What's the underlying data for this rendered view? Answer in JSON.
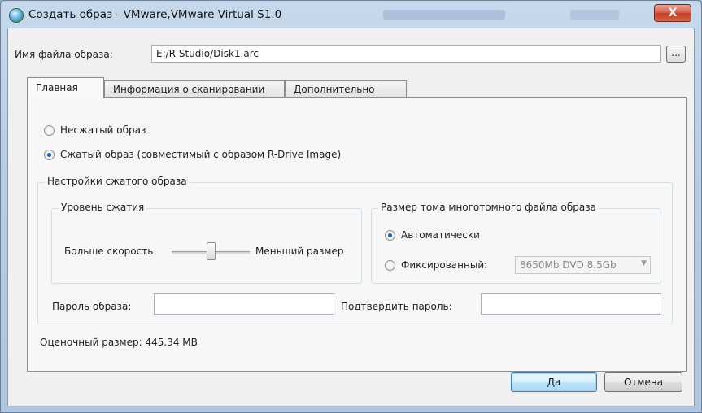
{
  "window": {
    "title": "Создать образ - VMware,VMware Virtual S1.0",
    "close_glyph": "X"
  },
  "file": {
    "label": "Имя файла образа:",
    "value": "E:/R-Studio/Disk1.arc",
    "browse_label": "..."
  },
  "tabs": [
    {
      "label": "Главная",
      "active": true
    },
    {
      "label": "Информация о сканировании",
      "active": false
    },
    {
      "label": "Дополнительно",
      "active": false
    }
  ],
  "main": {
    "uncompressed_label": "Несжатый образ",
    "uncompressed_checked": false,
    "compressed_label": "Сжатый образ (совместимый с образом R-Drive Image)",
    "compressed_checked": true,
    "settings_group_title": "Настройки сжатого образа",
    "compression_group_title": "Уровень сжатия",
    "slider_left_label": "Больше скорость",
    "slider_right_label": "Меньший размер",
    "slider_value": 0.5,
    "volume_group_title": "Размер тома многотомного файла образа",
    "auto_label": "Автоматически",
    "auto_checked": true,
    "fixed_label": "Фиксированный:",
    "fixed_checked": false,
    "fixed_selected": "8650Mb DVD 8.5Gb",
    "password_label": "Пароль образа:",
    "password_value": "",
    "confirm_label": "Подтвердить пароль:",
    "confirm_value": "",
    "estimated_size": "Оценочный размер: 445.34 MB"
  },
  "buttons": {
    "ok": "Да",
    "cancel": "Отмена"
  }
}
